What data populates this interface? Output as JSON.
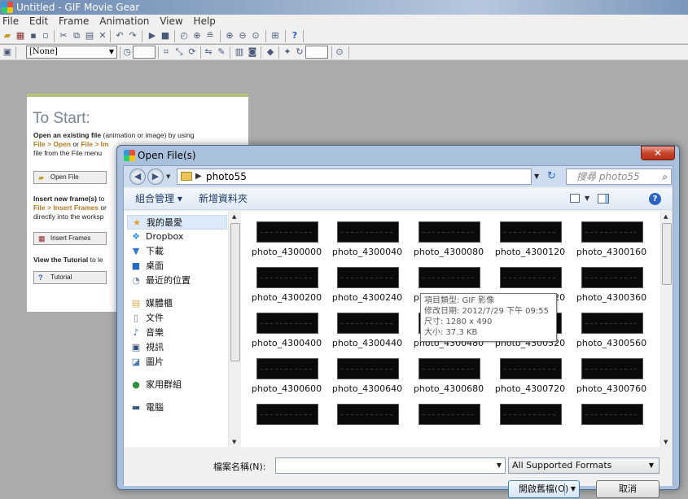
{
  "app": {
    "title": "Untitled - GIF Movie Gear",
    "menu": [
      "File",
      "Edit",
      "Frame",
      "Animation",
      "View",
      "Help"
    ],
    "palette_select": "[None]"
  },
  "start_panel": {
    "heading": "To Start:",
    "open_bold": "Open an existing file",
    "open_rest": " (animation or image) by using",
    "open_link": "File > Open",
    "open_or": " or ",
    "open_link2": "File > Im",
    "open_tail": "file from the File menu",
    "open_button": "Open File",
    "insert_bold": "Insert new frame(s)",
    "insert_rest": " to",
    "insert_link": "File > Insert Frames",
    "insert_link_rest": " or",
    "insert_tail": "directly into the worksp",
    "insert_button": "Insert Frames",
    "tutorial_bold": "View the Tutorial",
    "tutorial_rest": " to le",
    "tutorial_button": "Tutorial"
  },
  "dialog": {
    "title": "Open File(s)",
    "close_icon": "close-icon",
    "breadcrumb": "photo55",
    "search_placeholder": "搜尋 photo55",
    "commands": {
      "organize": "組合管理 ▾",
      "new_folder": "新增資料夾"
    },
    "nav_items": [
      {
        "label": "我的最愛",
        "icon": "★",
        "color": "#e0a526"
      },
      {
        "label": "Dropbox",
        "icon": "❖",
        "color": "#3b8fe0"
      },
      {
        "label": "下載",
        "icon": "▼",
        "color": "#3478c8"
      },
      {
        "label": "桌面",
        "icon": "■",
        "color": "#2a6bc2"
      },
      {
        "label": "最近的位置",
        "icon": "◔",
        "color": "#6d87a6"
      },
      {
        "label": "媒體櫃",
        "icon": "▤",
        "color": "#d4a84b"
      },
      {
        "label": "文件",
        "icon": "▯",
        "color": "#6d87a6"
      },
      {
        "label": "音樂",
        "icon": "♪",
        "color": "#3060b0"
      },
      {
        "label": "視訊",
        "icon": "▣",
        "color": "#33507a"
      },
      {
        "label": "圖片",
        "icon": "◪",
        "color": "#4a7bb5"
      },
      {
        "label": "家用群組",
        "icon": "●",
        "color": "#2f8f3c"
      },
      {
        "label": "電腦",
        "icon": "▬",
        "color": "#3a5a82"
      }
    ],
    "files": [
      "photo_4300000",
      "photo_4300040",
      "photo_4300080",
      "photo_4300120",
      "photo_4300160",
      "photo_4300200",
      "photo_4300240",
      "photo_4300280",
      "photo_4300320",
      "photo_4300360",
      "photo_4300400",
      "photo_4300440",
      "photo_4300480",
      "photo_4300520",
      "photo_4300560",
      "photo_4300600",
      "photo_4300640",
      "photo_4300680",
      "photo_4300720",
      "photo_4300760",
      "",
      "",
      "",
      "",
      ""
    ],
    "tooltip": {
      "type": "項目類型: GIF 影像",
      "modified": "修改日期: 2012/7/29 下午 09:55",
      "dimensions": "尺寸: 1280 x 490",
      "size": "大小: 37.3 KB"
    },
    "filename_label": "檔案名稱(N):",
    "filename_value": "",
    "filetype": "All Supported Formats",
    "open_button": "開啟舊檔(O)",
    "cancel_button": "取消"
  }
}
